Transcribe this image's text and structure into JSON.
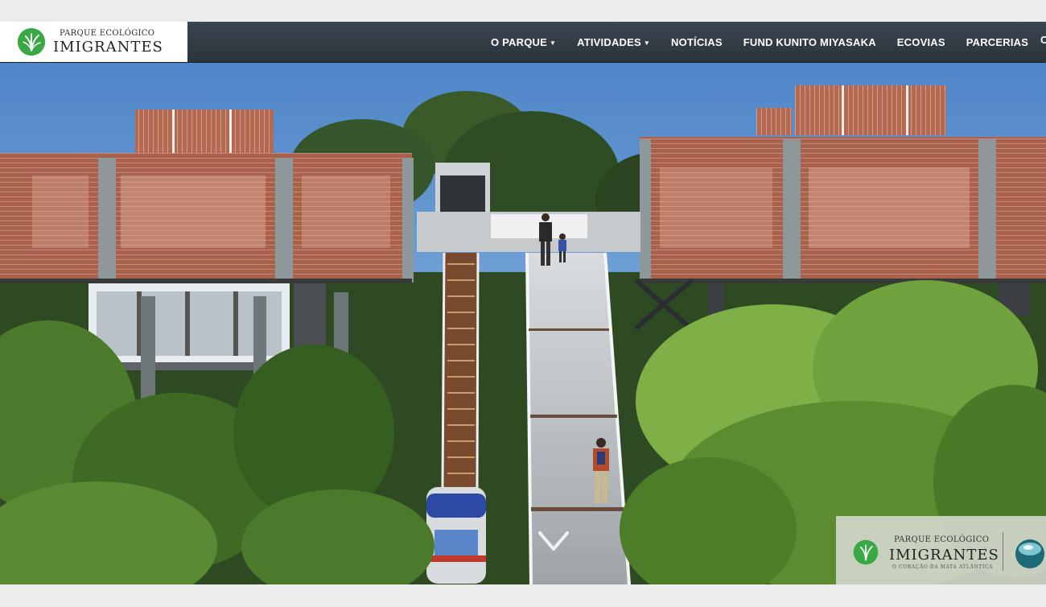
{
  "logo": {
    "small": "PARQUE ECOLÓGICO",
    "big": "IMIGRANTES"
  },
  "menu": {
    "items": [
      {
        "label": "O PARQUE",
        "dropdown": true
      },
      {
        "label": "ATIVIDADES",
        "dropdown": true
      },
      {
        "label": "NOTÍCIAS",
        "dropdown": false
      },
      {
        "label": "FUND KUNITO MIYASAKA",
        "dropdown": false
      },
      {
        "label": "ECOVIAS",
        "dropdown": false
      },
      {
        "label": "PARCERIAS",
        "dropdown": false
      }
    ],
    "truncated_label": "C",
    "caret": "▼"
  },
  "hero": {
    "image": "architectural rendering of elevated buildings, funicular and walkway in forest"
  },
  "badge": {
    "small": "PARQUE ECOLÓGICO",
    "big": "IMIGRANTES",
    "tagline": "O CORAÇÃO DA MATA ATLÂNTICA"
  },
  "colors": {
    "navbar": "#2f3942",
    "logo_green": "#3aa845",
    "brick": "#a8614a"
  },
  "icons": {
    "logo": "palm-leaf-icon",
    "scroll": "chevron-down-icon",
    "partner": "globe-icon"
  }
}
